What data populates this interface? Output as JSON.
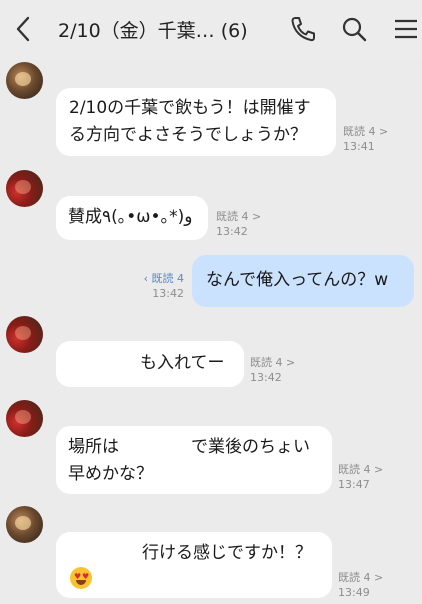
{
  "header": {
    "title": "2/10（金）千葉… (6)"
  },
  "messages": [
    {
      "text_lines": [
        "2/10の千葉で飲もう！は開催す",
        "る方向でよさそうでしょうか？"
      ],
      "read": "既読 4 >",
      "time": "13:41"
    },
    {
      "text_lines": [
        "賛成٩(｡•ω•｡*)و"
      ],
      "read": "既読 4 >",
      "time": "13:42"
    },
    {
      "text_lines": [
        "なんで俺入ってんの？w"
      ],
      "read": "既読 4",
      "time": "13:42"
    },
    {
      "text_lines": [
        "も入れてー"
      ],
      "read": "既読 4 >",
      "time": "13:42"
    },
    {
      "text_lines": [
        "で業後のちょい",
        "早めかな？"
      ],
      "line1_prefix": "場所は",
      "read": "既読 4 >",
      "time": "13:47"
    },
    {
      "text_lines": [
        "行ける感じですか！？"
      ],
      "read": "既読 4 >",
      "time": "13:49"
    }
  ],
  "colors": {
    "background": "#ebebeb",
    "my_bubble": "#cbe2ff",
    "other_bubble": "#ffffff",
    "read_link": "#5b88c4"
  }
}
